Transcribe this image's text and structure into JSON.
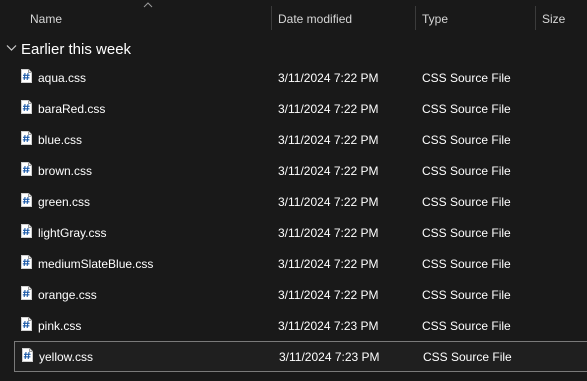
{
  "columns": {
    "name": "Name",
    "date_modified": "Date modified",
    "type": "Type",
    "size": "Size"
  },
  "sort": {
    "column": "name",
    "direction": "ascending",
    "indicator_icon": "sort-up-icon"
  },
  "group": {
    "label": "Earlier this week",
    "expanded": true,
    "icon": "chevron-down-icon"
  },
  "files": [
    {
      "name": "aqua.css",
      "date": "3/11/2024 7:22 PM",
      "type": "CSS Source File",
      "size": "",
      "icon": "css-file-icon"
    },
    {
      "name": "baraRed.css",
      "date": "3/11/2024 7:22 PM",
      "type": "CSS Source File",
      "size": "",
      "icon": "css-file-icon"
    },
    {
      "name": "blue.css",
      "date": "3/11/2024 7:22 PM",
      "type": "CSS Source File",
      "size": "",
      "icon": "css-file-icon"
    },
    {
      "name": "brown.css",
      "date": "3/11/2024 7:22 PM",
      "type": "CSS Source File",
      "size": "",
      "icon": "css-file-icon"
    },
    {
      "name": "green.css",
      "date": "3/11/2024 7:22 PM",
      "type": "CSS Source File",
      "size": "",
      "icon": "css-file-icon"
    },
    {
      "name": "lightGray.css",
      "date": "3/11/2024 7:22 PM",
      "type": "CSS Source File",
      "size": "",
      "icon": "css-file-icon"
    },
    {
      "name": "mediumSlateBlue.css",
      "date": "3/11/2024 7:22 PM",
      "type": "CSS Source File",
      "size": "",
      "icon": "css-file-icon"
    },
    {
      "name": "orange.css",
      "date": "3/11/2024 7:22 PM",
      "type": "CSS Source File",
      "size": "",
      "icon": "css-file-icon"
    },
    {
      "name": "pink.css",
      "date": "3/11/2024 7:23 PM",
      "type": "CSS Source File",
      "size": "",
      "icon": "css-file-icon"
    },
    {
      "name": "yellow.css",
      "date": "3/11/2024 7:23 PM",
      "type": "CSS Source File",
      "size": "",
      "icon": "css-file-icon",
      "focused": true
    }
  ],
  "colors": {
    "background": "#191919",
    "text": "#ffffff",
    "header_text": "#d6d6d6",
    "separator": "#3b3b3b",
    "focus_border": "#7a7a7a",
    "file_icon_page": "#ffffff",
    "file_icon_accent": "#1e5ba8"
  }
}
